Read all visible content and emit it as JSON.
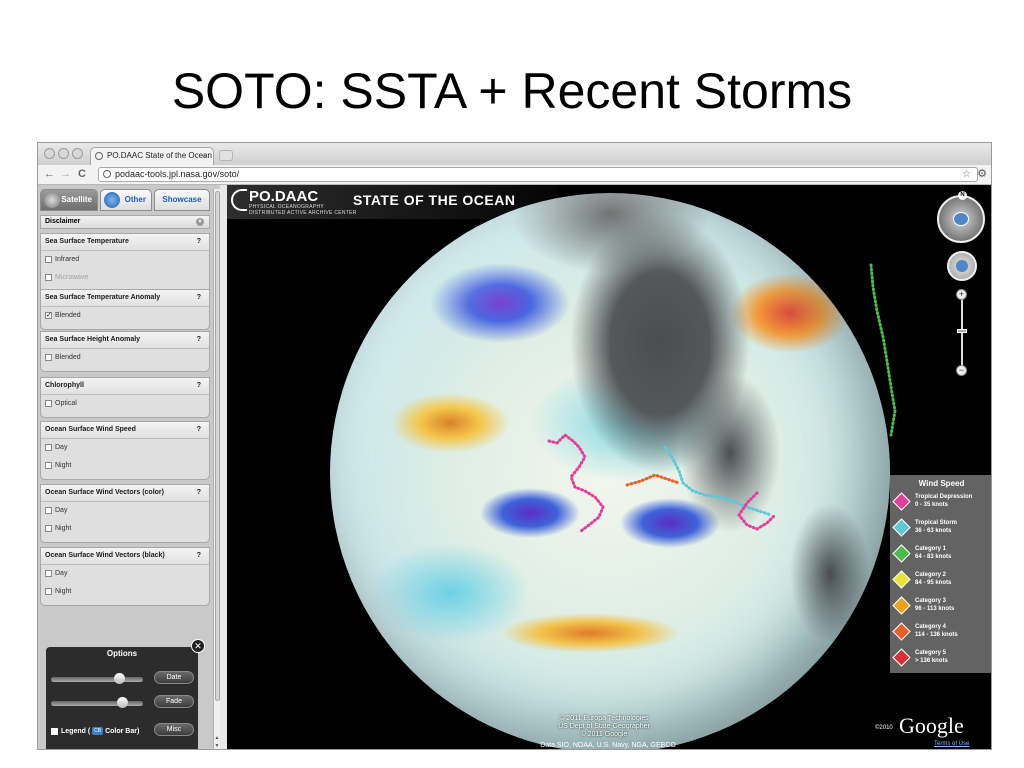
{
  "slide": {
    "title": "SOTO: SSTA + Recent Storms"
  },
  "browser": {
    "tab_title": "PO.DAAC State of the Ocean",
    "tab_close": "×",
    "back": "←",
    "forward": "→",
    "reload": "C",
    "url": "podaac-tools.jpl.nasa.gov/soto/",
    "star": "☆",
    "wrench": "🔧"
  },
  "sidebar": {
    "tabs": [
      {
        "label": "Satellite",
        "active": true
      },
      {
        "label": "Other",
        "active": false
      },
      {
        "label": "Showcase",
        "active": false
      }
    ],
    "disclaimer": "Disclaimer",
    "sections": [
      {
        "title": "Sea Surface Temperature",
        "help": "?",
        "items": [
          {
            "label": "Infrared",
            "checked": false,
            "disabled": false
          },
          {
            "label": "Microwave",
            "checked": false,
            "disabled": true
          },
          {
            "label": "Blended",
            "checked": false,
            "disabled": false
          }
        ]
      },
      {
        "title": "Sea Surface Temperature Anomaly",
        "help": "?",
        "items": [
          {
            "label": "Blended",
            "checked": true,
            "disabled": false
          }
        ]
      },
      {
        "title": "Sea Surface Height Anomaly",
        "help": "?",
        "items": [
          {
            "label": "Blended",
            "checked": false,
            "disabled": false
          }
        ]
      },
      {
        "title": "Chlorophyll",
        "help": "?",
        "items": [
          {
            "label": "Optical",
            "checked": false,
            "disabled": false
          }
        ]
      },
      {
        "title": "Ocean Surface Wind Speed",
        "help": "?",
        "items": [
          {
            "label": "Day",
            "checked": false,
            "disabled": false
          },
          {
            "label": "Night",
            "checked": false,
            "disabled": false
          }
        ]
      },
      {
        "title": "Ocean Surface Wind Vectors (color)",
        "help": "?",
        "items": [
          {
            "label": "Day",
            "checked": false,
            "disabled": false
          },
          {
            "label": "Night",
            "checked": false,
            "disabled": false
          }
        ]
      },
      {
        "title": "Ocean Surface Wind Vectors (black)",
        "help": "?",
        "items": [
          {
            "label": "Day",
            "checked": false,
            "disabled": false
          },
          {
            "label": "Night",
            "checked": false,
            "disabled": false
          }
        ]
      }
    ],
    "options": {
      "title": "Options",
      "close": "✕",
      "date_button": "Date",
      "fade_button": "Fade",
      "misc_button": "Misc",
      "legend_label": "Legend (",
      "legend_icon": "CB",
      "color_bar_label": "Color Bar)",
      "date_slider_value": 0.78,
      "fade_slider_value": 0.82
    }
  },
  "map": {
    "brand_name": "PO.DAAC",
    "brand_sub1": "PHYSICAL OCEANOGRAPHY",
    "brand_sub2": "DISTRIBUTED ACTIVE ARCHIVE CENTER",
    "heading": "STATE OF THE OCEAN",
    "compass_n": "N",
    "zoom_in": "+",
    "zoom_out": "−",
    "attribution": [
      "© 2011 Europa Technologies",
      "US Dept of State Geographer",
      "© 2011 Google"
    ],
    "data_credit": "Data SIO, NOAA, U.S. Navy, NGA, GEBCO",
    "google_year": "©2010",
    "google_logo": "Google",
    "terms": "Terms of Use",
    "icons": {
      "compass": "compass-icon",
      "pan": "pan-control-icon",
      "storm": "hurricane-icon"
    }
  },
  "wind_speed_legend": {
    "title": "Wind Speed",
    "items": [
      {
        "name": "Tropical Depression",
        "range": "0 - 35 knots",
        "color": "#e0409a"
      },
      {
        "name": "Tropical Storm",
        "range": "36 - 63 knots",
        "color": "#5ec8d8"
      },
      {
        "name": "Category 1",
        "range": "64 - 83 knots",
        "color": "#4fb84f"
      },
      {
        "name": "Category 2",
        "range": "84 - 95 knots",
        "color": "#e8e23a"
      },
      {
        "name": "Category 3",
        "range": "96 - 113 knots",
        "color": "#f0a020"
      },
      {
        "name": "Category 4",
        "range": "114 - 136 knots",
        "color": "#e8602a"
      },
      {
        "name": "Category 5",
        "range": "> 136 knots",
        "color": "#d8303a"
      }
    ]
  }
}
